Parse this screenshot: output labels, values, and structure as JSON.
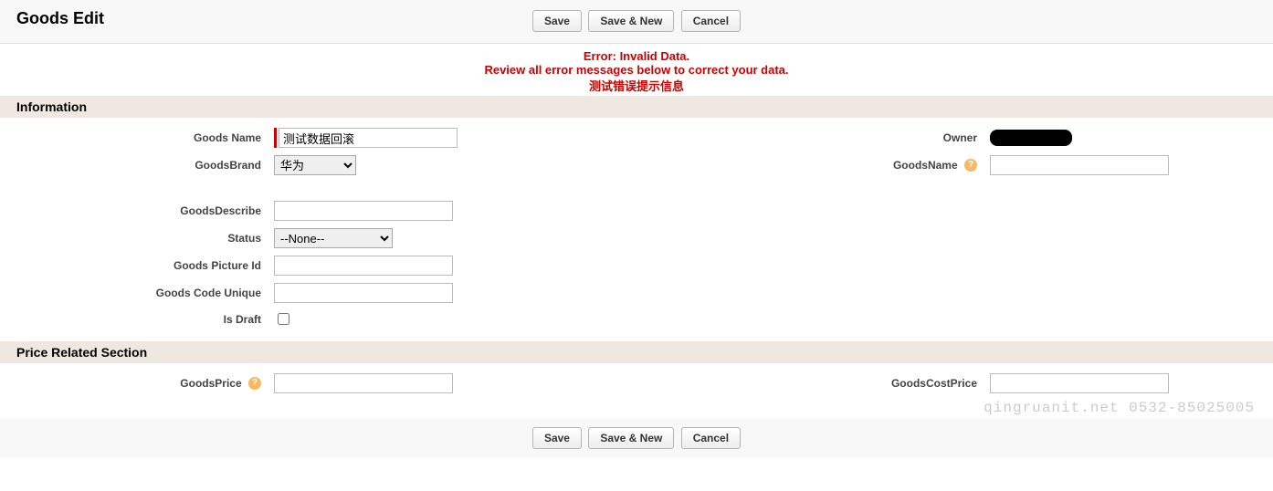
{
  "header": {
    "title": "Goods Edit",
    "buttons": {
      "save": "Save",
      "save_new": "Save & New",
      "cancel": "Cancel"
    }
  },
  "error": {
    "line1": "Error: Invalid Data.",
    "line2": "Review all error messages below to correct your data.",
    "line3": "测试错误提示信息"
  },
  "information": {
    "heading": "Information",
    "goods_name": {
      "label": "Goods Name",
      "value": "测试数据回滚"
    },
    "goods_brand": {
      "label": "GoodsBrand",
      "selected": "华为"
    },
    "goods_describe": {
      "label": "GoodsDescribe",
      "value": ""
    },
    "status": {
      "label": "Status",
      "selected": "--None--"
    },
    "goods_picture_id": {
      "label": "Goods Picture Id",
      "value": ""
    },
    "goods_code_unique": {
      "label": "Goods Code Unique",
      "value": ""
    },
    "is_draft": {
      "label": "Is Draft",
      "checked": false
    },
    "owner": {
      "label": "Owner"
    },
    "goods_name2": {
      "label": "GoodsName",
      "value": ""
    }
  },
  "price": {
    "heading": "Price Related Section",
    "goods_price": {
      "label": "GoodsPrice",
      "value": ""
    },
    "goods_cost_price": {
      "label": "GoodsCostPrice",
      "value": ""
    }
  },
  "watermark": "qingruanit.net 0532-85025005"
}
